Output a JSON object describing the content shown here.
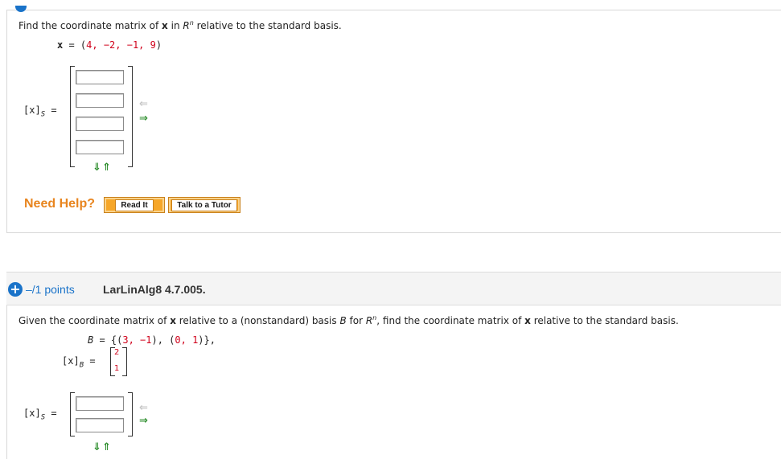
{
  "question1": {
    "prompt_pre": "Find the coordinate matrix of ",
    "prompt_x": "x",
    "prompt_mid": " in ",
    "prompt_R": "R",
    "prompt_n": "n",
    "prompt_post": " relative to the standard basis.",
    "vector_label": "x",
    "vector_eq": " = (",
    "vector_values": "4, −2, −1, 9",
    "vector_close": ")",
    "answer_label": "[x]",
    "answer_sub": "S",
    "answer_eq": " =",
    "answer_rows": 4,
    "answer_values": [
      "",
      "",
      "",
      ""
    ]
  },
  "help": {
    "need_help": "Need Help?",
    "read_it": "Read It",
    "talk_tutor": "Talk to a Tutor"
  },
  "question2": {
    "points": "–/1 points",
    "id": "LarLinAlg8 4.7.005.",
    "prompt_pre": "Given the coordinate matrix of ",
    "prompt_x": "x",
    "prompt_mid1": " relative to a (nonstandard) basis ",
    "prompt_B": "B",
    "prompt_mid2": " for ",
    "prompt_R": "R",
    "prompt_n": "n",
    "prompt_mid3": ", find the coordinate matrix of ",
    "prompt_x2": "x",
    "prompt_post": " relative to the standard basis.",
    "basis_label": "B",
    "basis_eq": " = {(",
    "basis_v1": "3, −1",
    "basis_mid": "), (",
    "basis_v2": "0, 1",
    "basis_close": ")},",
    "coord_label": "[x]",
    "coord_sub": "B",
    "coord_eq": " =",
    "coord_values": [
      "2",
      "1"
    ],
    "answer_label": "[x]",
    "answer_sub": "S",
    "answer_eq": " =",
    "answer_values": [
      "",
      ""
    ]
  },
  "icons": {
    "left_arrow": "⇐",
    "right_arrow": "⇒",
    "down_arrow": "⇓",
    "up_arrow": "⇑",
    "plus": "+"
  },
  "colors": {
    "accent": "#1a73c9",
    "help_orange": "#e8851f",
    "value_red": "#d0021b",
    "button_orange": "#f6a628"
  }
}
